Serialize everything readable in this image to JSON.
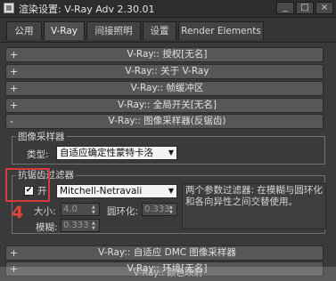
{
  "window": {
    "title": "渲染设置: V-Ray Adv 2.30.01",
    "minimize": "_",
    "maximize": "□",
    "close": "×"
  },
  "tabs": [
    "公用",
    "V-Ray",
    "间接照明",
    "设置",
    "Render Elements"
  ],
  "rollouts_top": [
    {
      "sign": "+",
      "title": "V-Ray:: 授权[无名]"
    },
    {
      "sign": "+",
      "title": "V-Ray:: 关于 V-Ray"
    },
    {
      "sign": "+",
      "title": "V-Ray:: 帧缓冲区"
    },
    {
      "sign": "+",
      "title": "V-Ray:: 全局开关[无名]"
    },
    {
      "sign": "-",
      "title": "V-Ray:: 图像采样器(反锯齿)"
    }
  ],
  "image_sampler": {
    "group_label": "图像采样器",
    "type_label": "类型:",
    "type_value": "自适应确定性蒙特卡洛"
  },
  "antialias_filter": {
    "group_label": "抗锯齿过滤器",
    "on_label": "开",
    "on_checked": "✔",
    "filter_value": "Mitchell-Netravali",
    "description": "两个参数过滤器: 在模糊与圆环化和各向异性之间交替使用。",
    "size_label": "大小:",
    "size_value": "4.0",
    "ringing_label": "圆环化:",
    "ringing_value": "0.333",
    "blur_label": "模糊:",
    "blur_value": "0.333"
  },
  "annotation": {
    "number": "4",
    "color": "#d73a3a"
  },
  "rollouts_bottom": [
    {
      "sign": "+",
      "title": "V-Ray:: 自适应 DMC 图像采样器"
    },
    {
      "sign": "+",
      "title": "V-Ray:: 环境[无名]"
    }
  ],
  "watermark": "V-Ray:: 颜色映射"
}
